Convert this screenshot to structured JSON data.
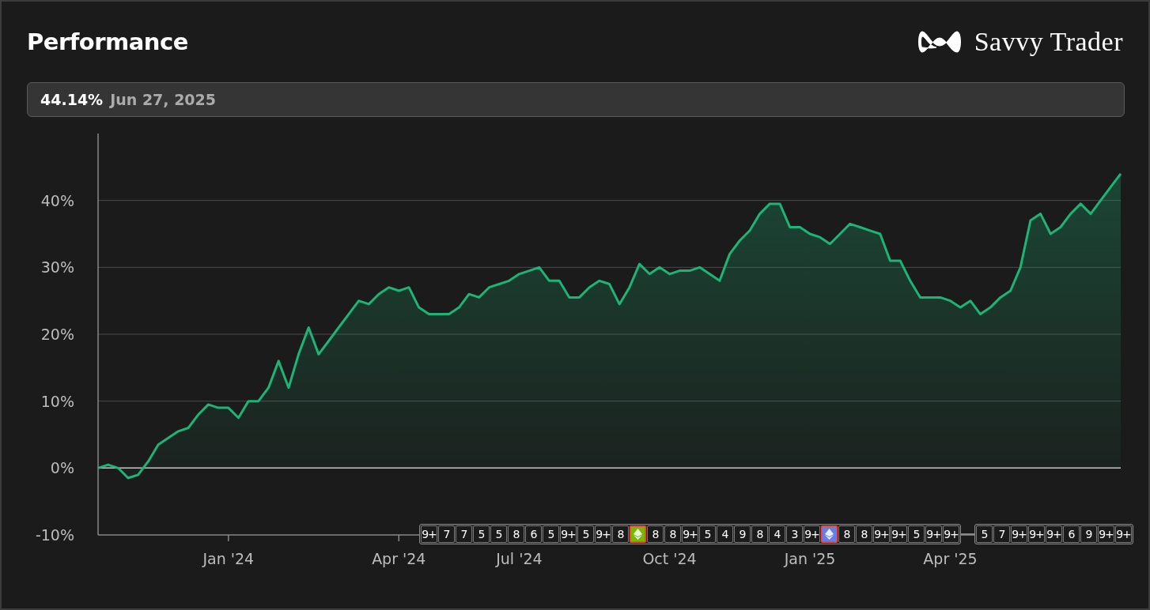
{
  "header": {
    "title": "Performance",
    "brand": "Savvy Trader"
  },
  "summary": {
    "value": "44.14%",
    "date": "Jun 27, 2025"
  },
  "chart_data": {
    "type": "area",
    "grid": true,
    "ylim": [
      -10,
      50
    ],
    "yticks": [
      {
        "value": -10,
        "label": "-10%"
      },
      {
        "value": 0,
        "label": "0%"
      },
      {
        "value": 10,
        "label": "10%"
      },
      {
        "value": 20,
        "label": "20%"
      },
      {
        "value": 30,
        "label": "30%"
      },
      {
        "value": 40,
        "label": "40%"
      }
    ],
    "categories": [
      null,
      null,
      null,
      null,
      null,
      null,
      null,
      null,
      null,
      null,
      null,
      null,
      null,
      "Jan '24",
      null,
      null,
      null,
      null,
      null,
      null,
      null,
      null,
      null,
      null,
      null,
      null,
      null,
      null,
      null,
      null,
      "Apr '24",
      null,
      null,
      null,
      null,
      null,
      null,
      null,
      null,
      null,
      null,
      null,
      "Jul '24",
      null,
      null,
      null,
      null,
      null,
      null,
      null,
      null,
      null,
      null,
      null,
      null,
      null,
      null,
      "Oct '24",
      null,
      null,
      null,
      null,
      null,
      null,
      null,
      null,
      null,
      null,
      null,
      null,
      null,
      "Jan '25",
      null,
      null,
      null,
      null,
      null,
      null,
      null,
      null,
      null,
      null,
      null,
      null,
      null,
      "Apr '25",
      null,
      null,
      null,
      null,
      null,
      null,
      null,
      null,
      null,
      null,
      null,
      null,
      null,
      null,
      null,
      null,
      null
    ],
    "series": [
      {
        "color": "#1db477",
        "values": [
          0,
          0.5,
          0,
          -1.5,
          -1,
          1,
          3.5,
          4.5,
          5.5,
          6,
          8,
          9.5,
          9,
          9,
          7.5,
          10,
          10,
          12,
          16,
          12,
          17,
          21,
          17,
          19,
          21,
          23,
          25,
          24.5,
          26,
          27,
          26.5,
          27,
          24,
          23,
          23,
          23,
          24,
          26,
          25.5,
          27,
          27.5,
          28,
          29,
          29.5,
          30,
          28,
          28,
          25.5,
          25.5,
          27,
          28,
          27.5,
          24.5,
          27,
          30.5,
          29,
          30,
          29,
          29.5,
          29.5,
          30,
          29,
          28,
          32,
          34,
          35.5,
          38,
          39.5,
          39.5,
          36,
          36,
          35,
          34.5,
          33.5,
          35,
          36.5,
          36,
          35.5,
          35,
          31,
          31,
          28,
          25.5,
          25.5,
          25.5,
          25,
          24,
          25,
          23,
          24,
          25.5,
          26.5,
          30,
          37,
          38,
          35,
          36,
          38,
          39.5,
          38,
          40,
          42,
          44
        ]
      }
    ]
  },
  "marker_groups": [
    [
      {
        "kind": "count",
        "label": "9+"
      },
      {
        "kind": "count",
        "label": "7"
      },
      {
        "kind": "count",
        "label": "7"
      },
      {
        "kind": "count",
        "label": "5"
      },
      {
        "kind": "count",
        "label": "5"
      },
      {
        "kind": "count",
        "label": "8"
      },
      {
        "kind": "count",
        "label": "6"
      },
      {
        "kind": "count",
        "label": "5"
      },
      {
        "kind": "count",
        "label": "9+"
      },
      {
        "kind": "count",
        "label": "5"
      },
      {
        "kind": "count",
        "label": "9+"
      },
      {
        "kind": "count",
        "label": "8"
      },
      {
        "kind": "logo",
        "color": "#76b900"
      },
      {
        "kind": "count",
        "label": "8"
      },
      {
        "kind": "count",
        "label": "8"
      },
      {
        "kind": "count",
        "label": "9+"
      },
      {
        "kind": "count",
        "label": "5"
      },
      {
        "kind": "count",
        "label": "4"
      },
      {
        "kind": "count",
        "label": "9"
      },
      {
        "kind": "count",
        "label": "8"
      },
      {
        "kind": "count",
        "label": "4"
      },
      {
        "kind": "count",
        "label": "3"
      },
      {
        "kind": "count",
        "label": "9+"
      },
      {
        "kind": "logo",
        "color": "#627eea"
      },
      {
        "kind": "count",
        "label": "8"
      },
      {
        "kind": "count",
        "label": "8"
      },
      {
        "kind": "count",
        "label": "9+"
      },
      {
        "kind": "count",
        "label": "9+"
      },
      {
        "kind": "count",
        "label": "5"
      },
      {
        "kind": "count",
        "label": "9+"
      },
      {
        "kind": "count",
        "label": "9+"
      }
    ],
    [
      {
        "kind": "count",
        "label": "5"
      },
      {
        "kind": "count",
        "label": "7"
      },
      {
        "kind": "count",
        "label": "9+"
      },
      {
        "kind": "count",
        "label": "9+"
      },
      {
        "kind": "count",
        "label": "9+"
      },
      {
        "kind": "count",
        "label": "6"
      },
      {
        "kind": "count",
        "label": "9"
      },
      {
        "kind": "count",
        "label": "9+"
      },
      {
        "kind": "count",
        "label": "9+"
      }
    ]
  ]
}
